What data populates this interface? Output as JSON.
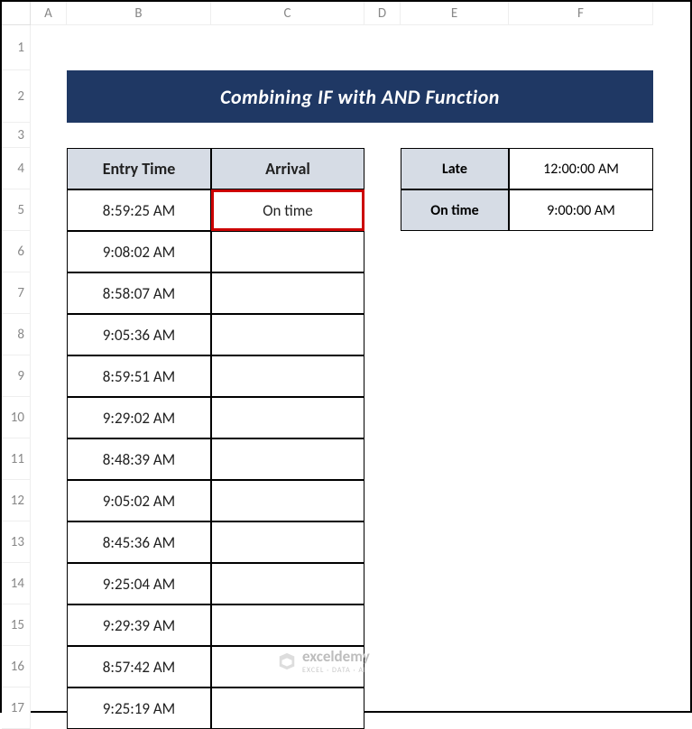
{
  "columns": [
    "A",
    "B",
    "C",
    "D",
    "E",
    "F"
  ],
  "rows": [
    "1",
    "2",
    "3",
    "4",
    "5",
    "6",
    "7",
    "8",
    "9",
    "10",
    "11",
    "12",
    "13",
    "14",
    "15",
    "16",
    "17"
  ],
  "title": "Combining IF with AND Function",
  "table": {
    "headers": {
      "entry": "Entry Time",
      "arrival": "Arrival"
    },
    "data": [
      {
        "entry": "8:59:25 AM",
        "arrival": "On time"
      },
      {
        "entry": "9:08:02 AM",
        "arrival": ""
      },
      {
        "entry": "8:58:07 AM",
        "arrival": ""
      },
      {
        "entry": "9:05:36 AM",
        "arrival": ""
      },
      {
        "entry": "8:59:51 AM",
        "arrival": ""
      },
      {
        "entry": "9:29:02 AM",
        "arrival": ""
      },
      {
        "entry": "8:48:39 AM",
        "arrival": ""
      },
      {
        "entry": "9:05:02 AM",
        "arrival": ""
      },
      {
        "entry": "8:45:36 AM",
        "arrival": ""
      },
      {
        "entry": "9:25:04 AM",
        "arrival": ""
      },
      {
        "entry": "9:29:39 AM",
        "arrival": ""
      },
      {
        "entry": "8:57:42 AM",
        "arrival": ""
      },
      {
        "entry": "9:25:19 AM",
        "arrival": ""
      }
    ]
  },
  "side": {
    "late_label": "Late",
    "late_value": "12:00:00 AM",
    "ontime_label": "On time",
    "ontime_value": "9:00:00 AM"
  },
  "watermark": {
    "name": "exceldemy",
    "sub": "EXCEL · DATA · AI"
  }
}
